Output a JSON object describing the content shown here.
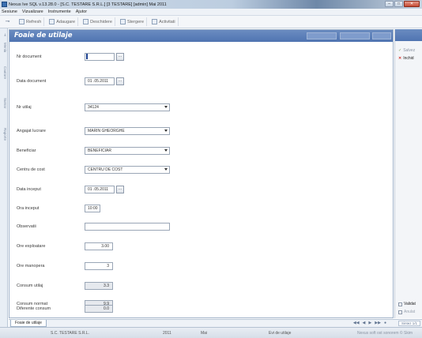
{
  "window": {
    "title": "Nexus Ive SQL v.13.28.0 - [S.C. TESTARE S.R.L.] [3 TESTARE] [admin] Mai 2011",
    "buttons": {
      "minimize": "–",
      "maximize": "□",
      "close": "✕"
    }
  },
  "menu": {
    "items": [
      "Sesiune",
      "Vizualizare",
      "Instrumente",
      "Ajutor"
    ]
  },
  "toolbar": {
    "refresh": "Refresh",
    "add": "Adaugare",
    "detail": "Deschidere",
    "delete": "Stergere",
    "print": "Activitati"
  },
  "left_tabs": [
    "Meniu",
    "Cautare",
    "Sumar",
    "Raporte"
  ],
  "panel": {
    "title": "Foaie de utilaje"
  },
  "form": {
    "nr_document": {
      "label": "Nr document",
      "value": ""
    },
    "data_document": {
      "label": "Data document",
      "value": "01 .05.2011"
    },
    "nr_utilaj": {
      "label": "Nr utilaj",
      "value": "34124"
    },
    "angajat": {
      "label": "Angajat lucrare",
      "value": "MARIN GHEORGHE"
    },
    "beneficiar": {
      "label": "Beneficiar",
      "value": "BENEFICIAR"
    },
    "centru_cost": {
      "label": "Centru de cost",
      "value": "CENTRU DE COST"
    },
    "data_inceput": {
      "label": "Data inceput",
      "value": "01 .05.2011"
    },
    "ora_inceput": {
      "label": "Ora inceput",
      "value": "10:00"
    },
    "observatii": {
      "label": "Observatii",
      "value": ""
    },
    "ore_exploatare": {
      "label": "Ore exploatare",
      "value": "3.00"
    },
    "ore_manopera": {
      "label": "Ore manopera",
      "value": "3"
    },
    "consum_utilaj": {
      "label": "Consum utilaj",
      "value": "3.3"
    },
    "consum_normat": {
      "label": "Consum normat",
      "value": "9.9"
    },
    "diferenta_consum": {
      "label": "Diferente consum",
      "value": "0.0"
    }
  },
  "ellipsis": "...",
  "right_panel": {
    "save": "Salvez",
    "close": "Inchid",
    "option1": "Validat",
    "option2": "Anulat"
  },
  "bottom": {
    "tab": "Foaie de utilaje",
    "nav": [
      "◀◀",
      "◀",
      "▶",
      "▶▶",
      "●"
    ],
    "page": "Sintez 1/1"
  },
  "status": {
    "company": "S.C. TESTARE S.R.L.",
    "year": "2011",
    "month": "Mai",
    "module": "Evi de utilaje",
    "hint": "Nexus soft ost sonorem © Skim"
  }
}
